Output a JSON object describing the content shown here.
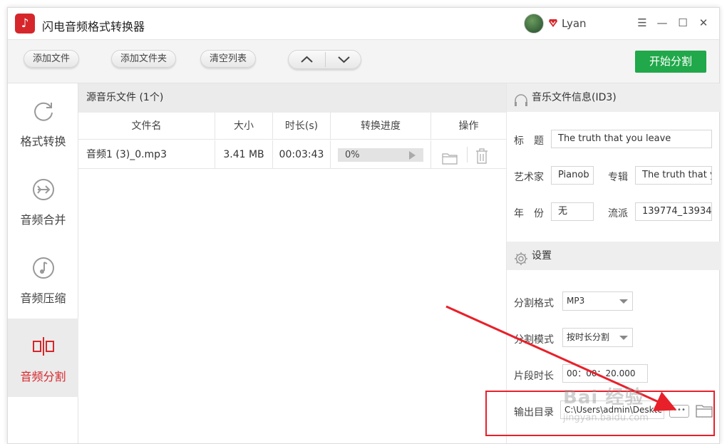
{
  "app": {
    "title": "闪电音频格式转换器",
    "logo_glyph": "♪",
    "user": "Lyan",
    "window_controls": [
      "☰",
      "—",
      "☐",
      "✕"
    ]
  },
  "toolbar": {
    "add_file": "添加文件",
    "add_folder": "添加文件夹",
    "clear_list": "清空列表",
    "up_icon": "chevron-up-icon",
    "down_icon": "chevron-down-icon",
    "start_split": "开始分割"
  },
  "sidebar": {
    "items": [
      {
        "label": "格式转换",
        "icon": "refresh-icon",
        "active": false
      },
      {
        "label": "音频合并",
        "icon": "merge-icon",
        "active": false
      },
      {
        "label": "音频压缩",
        "icon": "music-note-icon",
        "active": false
      },
      {
        "label": "音频分割",
        "icon": "split-icon",
        "active": true
      }
    ]
  },
  "file_list": {
    "header": "源音乐文件 (1个)",
    "columns": [
      "文件名",
      "大小",
      "时长(s)",
      "转换进度",
      "操作"
    ],
    "rows": [
      {
        "name": "音频1 (3)_0.mp3",
        "size": "3.41 MB",
        "duration": "00:03:43",
        "progress": "0%"
      }
    ]
  },
  "id3": {
    "header": "音乐文件信息(ID3)",
    "title_label": "标　题",
    "title_value": "The truth that you leave",
    "artist_label": "艺术家",
    "artist_value": "Pianob",
    "album_label": "专辑",
    "album_value": "The truth that y",
    "year_label": "年　份",
    "year_value": "无",
    "genre_label": "流派",
    "genre_value": "139774_13934"
  },
  "settings": {
    "header": "设置",
    "format_label": "分割格式",
    "format_value": "MP3",
    "mode_label": "分割模式",
    "mode_value": "按时长分割",
    "segment_label": "片段时长",
    "segment_value": "00：00：20.000",
    "output_label": "输出目录",
    "output_value": "C:\\Users\\admin\\Desktc",
    "more_glyph": "•••"
  },
  "watermark": {
    "main": "Bai 经验",
    "sub": "jingyan.baidu.com"
  },
  "colors": {
    "accent_red": "#d6262b",
    "start_green": "#20a84a",
    "annotation_red": "#e8202a"
  }
}
